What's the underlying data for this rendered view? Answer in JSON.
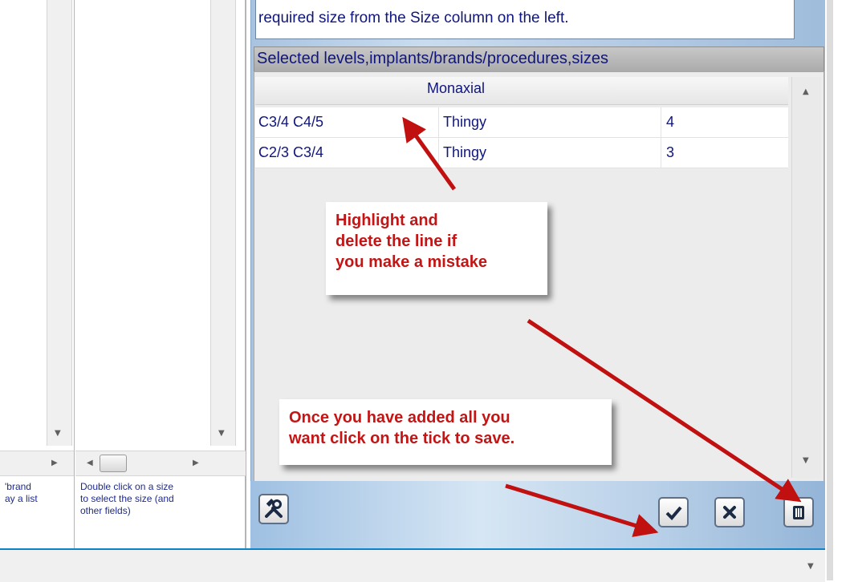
{
  "info": {
    "text": "required size from the Size column on the left."
  },
  "selected": {
    "title": "Selected levels,implants/brands/procedures,sizes",
    "group_header": "Monaxial",
    "rows": [
      {
        "levels": "C3/4 C4/5",
        "implant": "Thingy",
        "size": "4"
      },
      {
        "levels": "C2/3 C3/4",
        "implant": "Thingy",
        "size": "3"
      }
    ]
  },
  "left_help": {
    "col1": [
      "'brand",
      "ay a list"
    ],
    "col2": [
      "Double click on a size",
      "to select the size (and",
      "other fields)"
    ]
  },
  "callouts": {
    "delete": [
      "Highlight and",
      "delete the line if",
      "you make a mistake"
    ],
    "save": [
      "Once you have added all you",
      "want click on the tick to save."
    ]
  },
  "icons": {
    "tools": "tools-icon",
    "confirm": "checkmark-icon",
    "cancel": "cross-icon",
    "delete": "trash-icon"
  },
  "colors": {
    "text_blue": "#10167a",
    "callout_red": "#c41414",
    "arrow_red": "#c01010"
  }
}
